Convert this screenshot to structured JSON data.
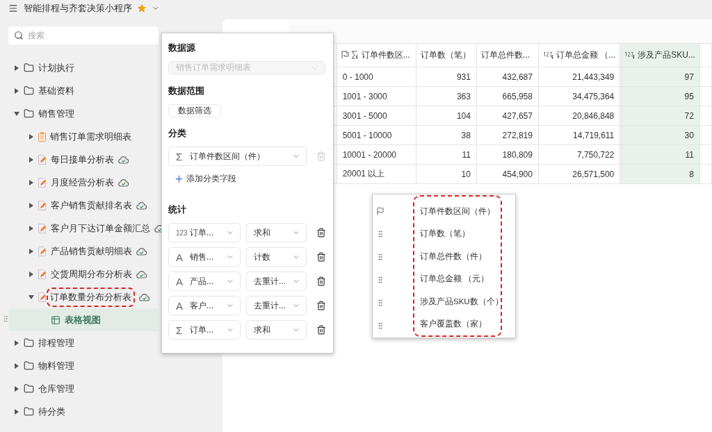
{
  "app": {
    "title": "智能排程与齐套决策小程序",
    "starred": true
  },
  "search": {
    "placeholder": "搜索"
  },
  "tree": [
    {
      "kind": "folder",
      "label": "计划执行",
      "expanded": false
    },
    {
      "kind": "folder",
      "label": "基础资料",
      "expanded": false
    },
    {
      "kind": "folder",
      "label": "销售管理",
      "expanded": true,
      "children": [
        {
          "kind": "sheet",
          "label": "销售订单需求明细表",
          "expanded": false,
          "synced": false,
          "highlighted": false
        },
        {
          "kind": "report",
          "label": "每日接单分析表",
          "expanded": false,
          "synced": true,
          "highlighted": false
        },
        {
          "kind": "report",
          "label": "月度经营分析表",
          "expanded": false,
          "synced": true,
          "highlighted": false
        },
        {
          "kind": "report",
          "label": "客户销售贡献排名表",
          "expanded": false,
          "synced": true,
          "highlighted": false
        },
        {
          "kind": "report",
          "label": "客户月下达订单金额汇总",
          "expanded": false,
          "synced": true,
          "highlighted": false
        },
        {
          "kind": "report",
          "label": "产品销售贡献明细表",
          "expanded": false,
          "synced": true,
          "highlighted": false
        },
        {
          "kind": "report",
          "label": "交货周期分布分析表",
          "expanded": false,
          "synced": true,
          "highlighted": false
        },
        {
          "kind": "report",
          "label": "订单数量分布分析表",
          "expanded": true,
          "synced": true,
          "highlighted": true,
          "children": [
            {
              "kind": "view",
              "label": "表格视图",
              "selected": true
            }
          ]
        }
      ]
    },
    {
      "kind": "folder",
      "label": "排程管理",
      "expanded": false
    },
    {
      "kind": "folder",
      "label": "物料管理",
      "expanded": false
    },
    {
      "kind": "folder",
      "label": "仓库管理",
      "expanded": false
    },
    {
      "kind": "folder",
      "label": "待分类",
      "expanded": false
    }
  ],
  "table": {
    "columns": [
      {
        "label": "订单件数区...",
        "kind": "group",
        "selected": false
      },
      {
        "label": "订单数（笔）",
        "kind": "plain",
        "selected": false
      },
      {
        "label": "订单总件数...",
        "kind": "plain",
        "selected": false
      },
      {
        "label": "订单总金额 （...",
        "kind": "formula",
        "selected": false
      },
      {
        "label": "涉及产品SKU...",
        "kind": "formula",
        "selected": true
      }
    ],
    "rows": [
      [
        "0 - 1000",
        "931",
        "432,687",
        "21,443,349",
        "97"
      ],
      [
        "1001 - 3000",
        "363",
        "665,958",
        "34,475,364",
        "95"
      ],
      [
        "3001 - 5000",
        "104",
        "427,657",
        "20,846,848",
        "72"
      ],
      [
        "5001 - 10000",
        "38",
        "272,819",
        "14,719,611",
        "30"
      ],
      [
        "10001 - 20000",
        "11",
        "180,809",
        "7,750,722",
        "11"
      ],
      [
        "20001 以上",
        "10",
        "454,900",
        "26,571,500",
        "8"
      ]
    ]
  },
  "config_panel": {
    "data_source": {
      "label": "数据源",
      "value": "销售订单需求明细表",
      "disabled": true
    },
    "data_range": {
      "label": "数据范围",
      "button": "数据筛选"
    },
    "category": {
      "label": "分类",
      "fields": [
        {
          "type_icon": "Σ",
          "name": "订单件数区间（件）",
          "delete_disabled": true
        }
      ],
      "add_label": "添加分类字段"
    },
    "stats": {
      "label": "统计",
      "rows": [
        {
          "type_icon": "123",
          "field": "订单...",
          "agg": "求和"
        },
        {
          "type_icon": "A",
          "field": "销售...",
          "agg": "计数"
        },
        {
          "type_icon": "A",
          "field": "产品...",
          "agg": "去重计..."
        },
        {
          "type_icon": "A",
          "field": "客户...",
          "agg": "去重计..."
        },
        {
          "type_icon": "Σ",
          "field": "订单...",
          "agg": "求和"
        }
      ]
    }
  },
  "field_list": {
    "annotated": true,
    "items": [
      {
        "kind": "pinned",
        "label": "订单件数区间（件）"
      },
      {
        "kind": "draggable",
        "label": "订单数（笔）"
      },
      {
        "kind": "draggable",
        "label": "订单总件数（件）"
      },
      {
        "kind": "draggable",
        "label": "订单总金额 （元）"
      },
      {
        "kind": "draggable",
        "label": "涉及产品SKU数（个）"
      },
      {
        "kind": "draggable",
        "label": "客户覆盖数（家）"
      }
    ]
  }
}
